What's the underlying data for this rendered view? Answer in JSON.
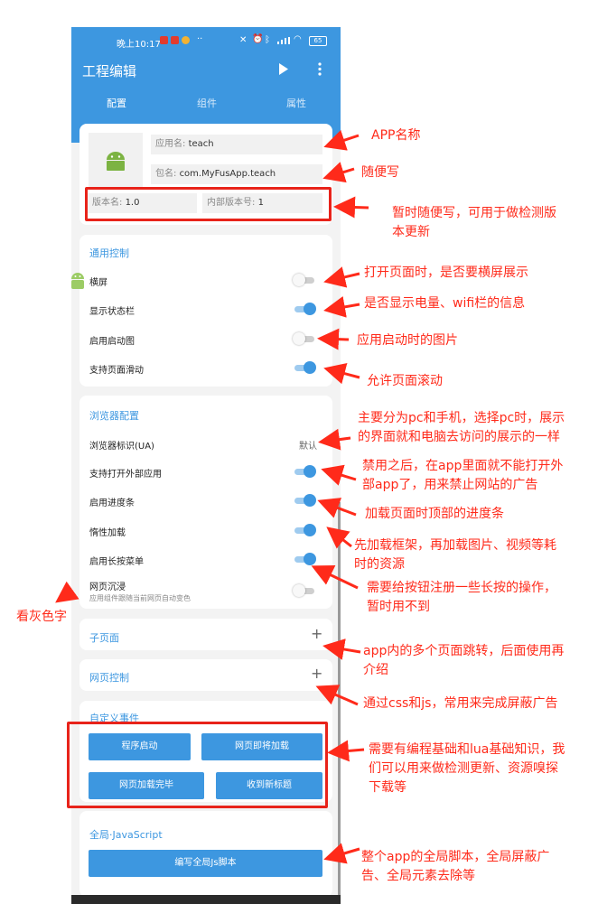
{
  "status_bar": {
    "time": "晚上10:17",
    "dots": "··",
    "battery": "65"
  },
  "app_bar": {
    "title": "工程编辑",
    "play_icon": "play-icon",
    "more_icon": "more-vert-icon"
  },
  "tabs": [
    {
      "label": "配置",
      "active": true
    },
    {
      "label": "组件",
      "active": false
    },
    {
      "label": "属性",
      "active": false
    }
  ],
  "app_info": {
    "app_name_label": "应用名:",
    "app_name_value": "teach",
    "package_label": "包名:",
    "package_value": "com.MyFusApp.teach",
    "version_name_label": "版本名:",
    "version_name_value": "1.0",
    "version_code_label": "内部版本号:",
    "version_code_value": "1"
  },
  "general": {
    "title": "通用控制",
    "items": [
      {
        "label": "横屏",
        "on": false
      },
      {
        "label": "显示状态栏",
        "on": true
      },
      {
        "label": "启用启动图",
        "on": false
      },
      {
        "label": "支持页面滑动",
        "on": true
      }
    ]
  },
  "browser": {
    "title": "浏览器配置",
    "ua_label": "浏览器标识(UA)",
    "ua_value": "默认",
    "items": [
      {
        "label": "支持打开外部应用",
        "on": true
      },
      {
        "label": "启用进度条",
        "on": true
      },
      {
        "label": "惰性加载",
        "on": true
      },
      {
        "label": "启用长按菜单",
        "on": true
      }
    ],
    "immersive_label": "网页沉浸",
    "immersive_sub": "应用组件跟随当前网页自动变色",
    "immersive_on": false
  },
  "subpage": {
    "title": "子页面",
    "plus": "+"
  },
  "webctrl": {
    "title": "网页控制",
    "plus": "+"
  },
  "events": {
    "title": "自定义事件",
    "buttons": [
      "程序启动",
      "网页即将加载",
      "网页加载完毕",
      "收到新标题"
    ]
  },
  "global_js": {
    "title": "全局·JavaScript",
    "button": "编写全局Js脚本"
  },
  "annotations": {
    "app_name": "APP名称",
    "package": "随便写",
    "version_1": "暂时随便写，可用于做检测版",
    "version_2": "本更新",
    "landscape": "打开页面时，是否要横屏展示",
    "statusbar": "是否显示电量、wifi栏的信息",
    "splash": "应用启动时的图片",
    "scroll": "允许页面滚动",
    "ua_1": "主要分为pc和手机，选择pc时，展示",
    "ua_2": "的界面就和电脑去访问的展示的一样",
    "external_1": "禁用之后，在app里面就不能打开外",
    "external_2": "部app了，用来禁止网站的广告",
    "progress": "加载页面时顶部的进度条",
    "lazy_1": "先加载框架，再加载图片、视频等耗",
    "lazy_2": "时的资源",
    "longpress_1": "需要给按钮注册一些长按的操作，",
    "longpress_2": "暂时用不到",
    "gray": "看灰色字",
    "subpage_1": "app内的多个页面跳转，后面使用再",
    "subpage_2": "介绍",
    "webctrl": "通过css和js，常用来完成屏蔽广告",
    "events_1": "需要有编程基础和lua基础知识，我",
    "events_2": "们可以用来做检测更新、资源嗅探",
    "events_3": "下载等",
    "globaljs_1": "整个app的全局脚本，全局屏蔽广",
    "globaljs_2": "告、全局元素去除等"
  },
  "colors": {
    "primary": "#3d97e0",
    "annotation": "#ff2a1a",
    "background": "#f3f3f3"
  }
}
